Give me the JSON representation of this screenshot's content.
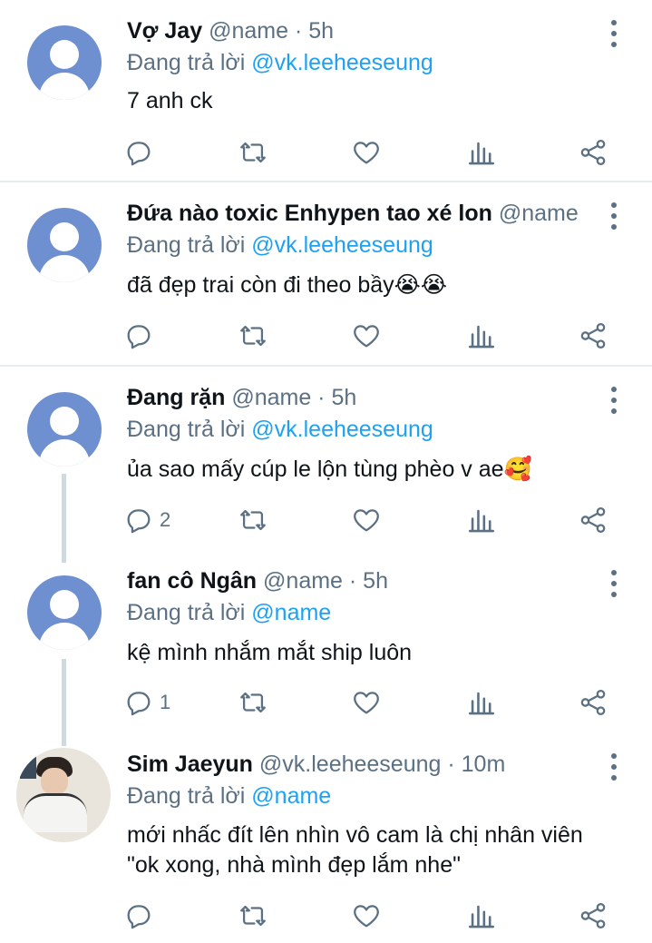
{
  "tweets": [
    {
      "name": "Vợ Jay",
      "handle": "@name",
      "time": "5h",
      "replying_prefix": "Đang trả lời ",
      "replying_to": "@vk.leeheeseung",
      "text": "7 anh ck",
      "emoji": "",
      "replies": ""
    },
    {
      "name": "Đứa nào toxic Enhypen tao xé lon",
      "handle": "@name",
      "time": "",
      "replying_prefix": "Đang trả lời ",
      "replying_to": "@vk.leeheeseung",
      "text": "đã đẹp trai còn đi theo bầy",
      "emoji": "😭😭",
      "replies": ""
    },
    {
      "name": "Đang rặn",
      "handle": "@name",
      "time": "5h",
      "replying_prefix": "Đang trả lời ",
      "replying_to": "@vk.leeheeseung",
      "text": "ủa sao mấy cúp le lộn tùng phèo v ae",
      "emoji": "🥰",
      "replies": "2"
    },
    {
      "name": "fan cô Ngân",
      "handle": "@name",
      "time": "5h",
      "replying_prefix": "Đang trả lời ",
      "replying_to": "@name",
      "text": "kệ mình nhắm mắt ship luôn",
      "emoji": "",
      "replies": "1"
    },
    {
      "name": "Sim Jaeyun",
      "handle": "@vk.leeheeseung",
      "time": "10m",
      "replying_prefix": "Đang trả lời ",
      "replying_to": "@name",
      "text": "mới nhấc đít lên nhìn vô cam là chị nhân viên \"ok xong, nhà mình đẹp lắm nhe\"",
      "emoji": "",
      "replies": ""
    }
  ],
  "separator": " · ",
  "icons": [
    "reply-icon",
    "retweet-icon",
    "like-icon",
    "analytics-icon",
    "share-icon",
    "more-icon"
  ],
  "colors": {
    "mention": "#1da1f2",
    "muted": "#5b7083",
    "avatar_default": "#6e8fd0"
  }
}
